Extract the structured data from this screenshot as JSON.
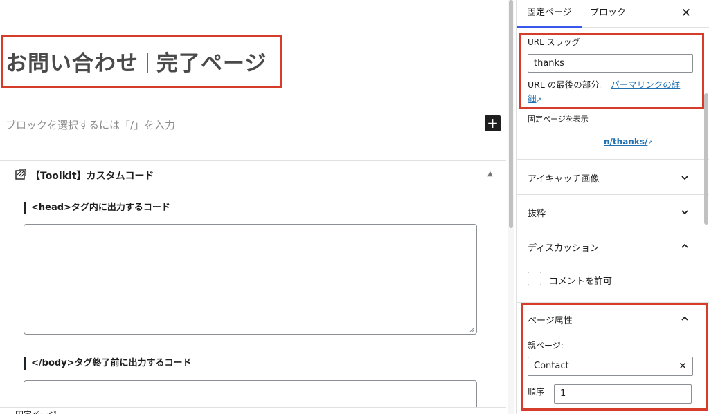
{
  "editor": {
    "title_part1": "お問い合わせ",
    "title_part2": "完了ページ",
    "block_placeholder": "ブロックを選択するには「/」を入力",
    "add_block_symbol": "+",
    "toolkit_title": "【Toolkit】カスタムコード",
    "head_label": "<head>タグ内に出力するコード",
    "head_value": "",
    "body_label": "</body>タグ終了前に出力するコード",
    "body_value": "",
    "footer_crumb": "固定ページ"
  },
  "sidebar": {
    "tabs": [
      "固定ページ",
      "ブロック"
    ],
    "active_tab": 0,
    "close_symbol": "✕",
    "url_slug_label": "URL スラッグ",
    "url_slug_value": "thanks",
    "url_help_text": "URL の最後の部分。",
    "permalink_link_line1": "パーマリンクの詳",
    "permalink_link_line2": "細",
    "view_page_label": "固定ページを表示",
    "view_page_url": "n/thanks/",
    "panels": {
      "featured_image": "アイキャッチ画像",
      "excerpt": "抜粋",
      "discussion": "ディスカッション",
      "page_attributes": "ページ属性"
    },
    "allow_comments_label": "コメントを許可",
    "allow_comments_checked": false,
    "parent_page_label": "親ページ:",
    "parent_page_value": "Contact",
    "order_label": "順序",
    "order_value": "1"
  },
  "colors": {
    "highlight_red": "#d63c2a",
    "accent_blue": "#3858e9",
    "link_blue": "#2271b1"
  },
  "icons": {
    "toolkit": "striped-block-icon",
    "external": "external-link-icon",
    "chevron_down": "chevron-down-icon",
    "chevron_up": "chevron-up-icon",
    "collapse": "triangle-up-icon",
    "clear": "clear-x-icon"
  }
}
